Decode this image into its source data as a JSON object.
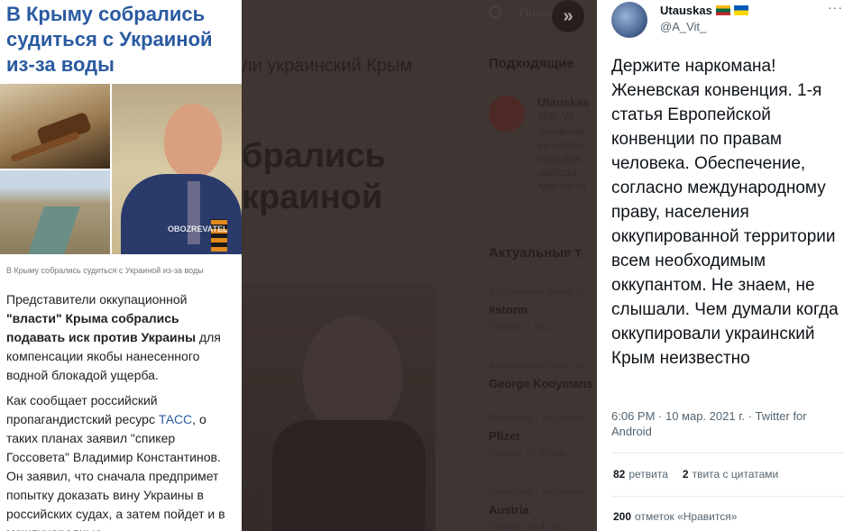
{
  "article": {
    "title": "В Крыму собрались судиться с Украиной из-за воды",
    "image_logo": "OBOZREVATEL",
    "caption": "В Крыму собрались судиться с Украиной из-за воды",
    "p1_a": "Представители оккупационной ",
    "p1_bold": "\"власти\" Крыма собрались подавать иск против Украины",
    "p1_b": " для компенсации якобы нанесенного водной блокадой ущерба.",
    "p2_a": "Как сообщает российский пропагандистский ресурс ",
    "p2_link": "ТАСС",
    "p2_b": ", о таких планах заявил \"спикер Госсовета\" Владимир Константинов. Он заявил, что сначала предпримет попытку доказать вину Украины в российских судах, а затем пойдет и в международные"
  },
  "background": {
    "headline": "ли украинский Крым",
    "big_line1": "брались",
    "big_line2": "краиной",
    "search_placeholder": "Поиск",
    "expand_glyph": "»",
    "suggested_title": "Подходящие",
    "suggested_user": {
      "name": "Utauskas",
      "handle": "@A_Vit_",
      "bio": [
        "Литовская",
        "русофоби",
        "честь//Ли",
        "свободы",
        "идет на бо"
      ]
    },
    "trends_title": "Актуальные т",
    "trends": [
      {
        "context": "Актуальные темы: Н",
        "name": "#storm",
        "count": "Твитов: 1 761"
      },
      {
        "context": "Актуальные темы: Н",
        "name": "George Kooymans",
        "count": ""
      },
      {
        "context": "Политика · Актуальн",
        "name": "Pfizer",
        "count": "Твитов: 92,2 тыс."
      },
      {
        "context": "Политика · Актуальн",
        "name": "Austria",
        "count": "Твитов: 20,4 тыс."
      }
    ]
  },
  "tweet": {
    "display_name": "Utauskas",
    "handle": "@A_Vit_",
    "more": "···",
    "text": "Держите наркомана! Женевская конвенция. 1-я статья Европейской конвенции по правам человека. Обеспечение, согласно международному праву, населения оккупированной территории всем необходимым оккупантом. Не знаем, не слышали. Чем думали когда оккупировали украинский Крым неизвестно",
    "time": "6:06 PM",
    "date": "10 мар. 2021 г.",
    "source": "Twitter for Android",
    "retweets_count": "82",
    "retweets_label": "ретвита",
    "quotes_count": "2",
    "quotes_label": "твита с цитатами",
    "likes_count": "200",
    "likes_label": "отметок «Нравится»"
  },
  "colors": {
    "article_title": "#2a5aa0",
    "link": "#2a5aa0",
    "tweet_text": "#0f1419",
    "tweet_secondary": "#536471",
    "dim_overlay": "#3a3230"
  }
}
